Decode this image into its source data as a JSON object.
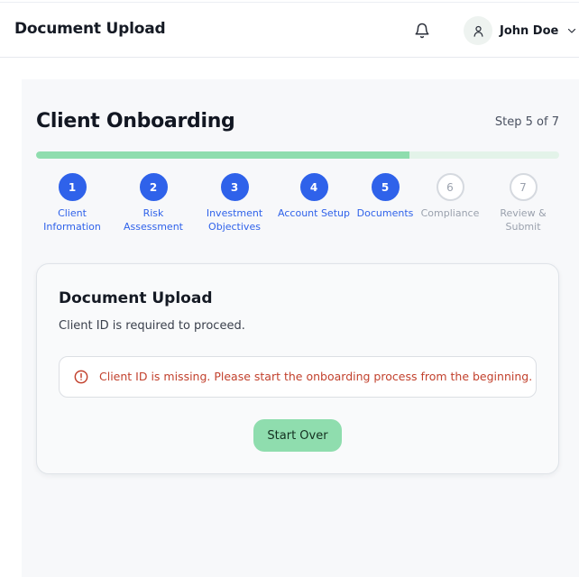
{
  "header": {
    "title": "Document Upload",
    "notification_icon": "bell-icon",
    "user_icon": "user-icon",
    "user_name": "John Doe",
    "menu_icon": "chevron-down-icon"
  },
  "page": {
    "title": "Client Onboarding",
    "step_indicator": "Step 5 of 7",
    "progress": {
      "current": 5,
      "total": 7
    }
  },
  "steps": [
    {
      "number": "1",
      "label_line1": "Client",
      "label_line2": "Information",
      "state": "complete"
    },
    {
      "number": "2",
      "label_line1": "Risk",
      "label_line2": "Assessment",
      "state": "complete"
    },
    {
      "number": "3",
      "label_line1": "Investment",
      "label_line2": "Objectives",
      "state": "complete"
    },
    {
      "number": "4",
      "label_line1": "Account Setup",
      "label_line2": "",
      "state": "complete"
    },
    {
      "number": "5",
      "label_line1": "Documents",
      "label_line2": "",
      "state": "current"
    },
    {
      "number": "6",
      "label_line1": "Compliance",
      "label_line2": "",
      "state": "upcoming"
    },
    {
      "number": "7",
      "label_line1": "Review &",
      "label_line2": "Submit",
      "state": "upcoming"
    }
  ],
  "card": {
    "title": "Document Upload",
    "description": "Client ID is required to proceed.",
    "alert": {
      "icon": "alert-circle-icon",
      "message": "Client ID is missing. Please start the onboarding process from the beginning."
    },
    "button_label": "Start Over"
  },
  "colors": {
    "accent_blue": "#2f62ea",
    "accent_green": "#8fddae",
    "error_red": "#c2412d"
  }
}
